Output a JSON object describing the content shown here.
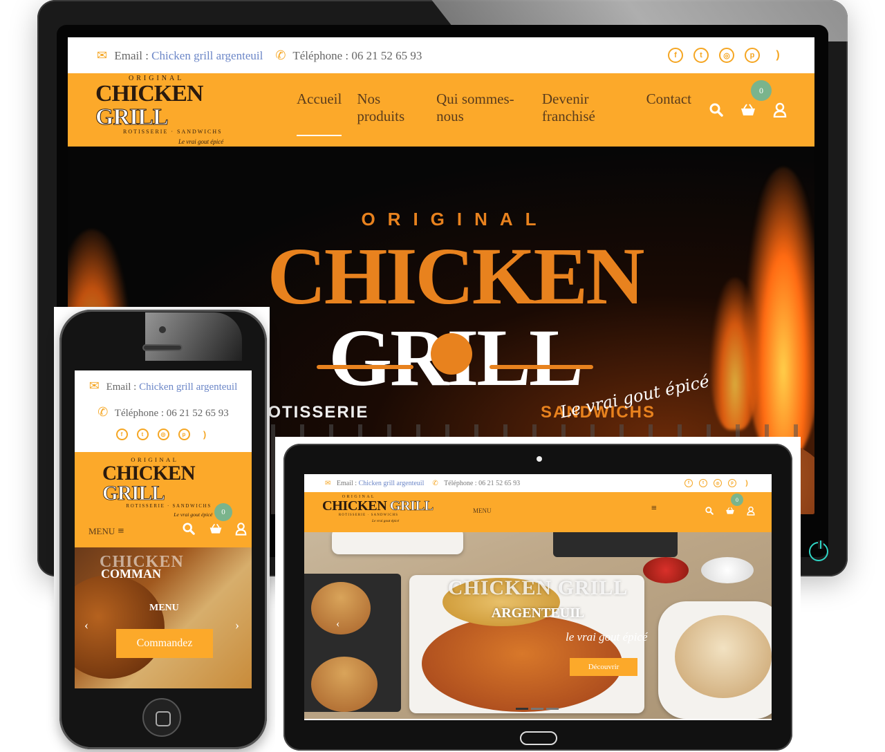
{
  "site": {
    "contact": {
      "email_label": "Email :",
      "email_value": "Chicken grill argenteuil",
      "phone_label": "Téléphone :",
      "phone_value": "06 21 52 65 93"
    },
    "socials": [
      "facebook-icon",
      "twitter-icon",
      "instagram-icon",
      "pinterest-icon",
      "rss-icon"
    ],
    "logo": {
      "original": "ORIGINAL",
      "brand_a": "CHICKEN",
      "brand_b": "GRILL",
      "sub_a": "ROTISSERIE",
      "sub_b": "SANDWICHS",
      "tagline": "Le vrai gout épicé"
    },
    "nav": [
      "Accueil",
      "Nos produits",
      "Qui sommes-nous",
      "Devenir franchisé",
      "Contact"
    ],
    "active_nav": "Accueil",
    "cart_count": "0",
    "accent": "#fca92a",
    "badge_color": "#7ab48c",
    "link_color": "#6b86c7"
  },
  "phone": {
    "menu_label": "MENU",
    "hero_headline": "COMMAN",
    "hero_sub": "MENU",
    "cta": "Commandez"
  },
  "tablet": {
    "menu_label": "MENU",
    "hero_title": "CHICKEN GRILL",
    "hero_subtitle": "ARGENTEUIL",
    "hero_tagline": "le vrai gout épicé",
    "cta": "Découvrir"
  }
}
